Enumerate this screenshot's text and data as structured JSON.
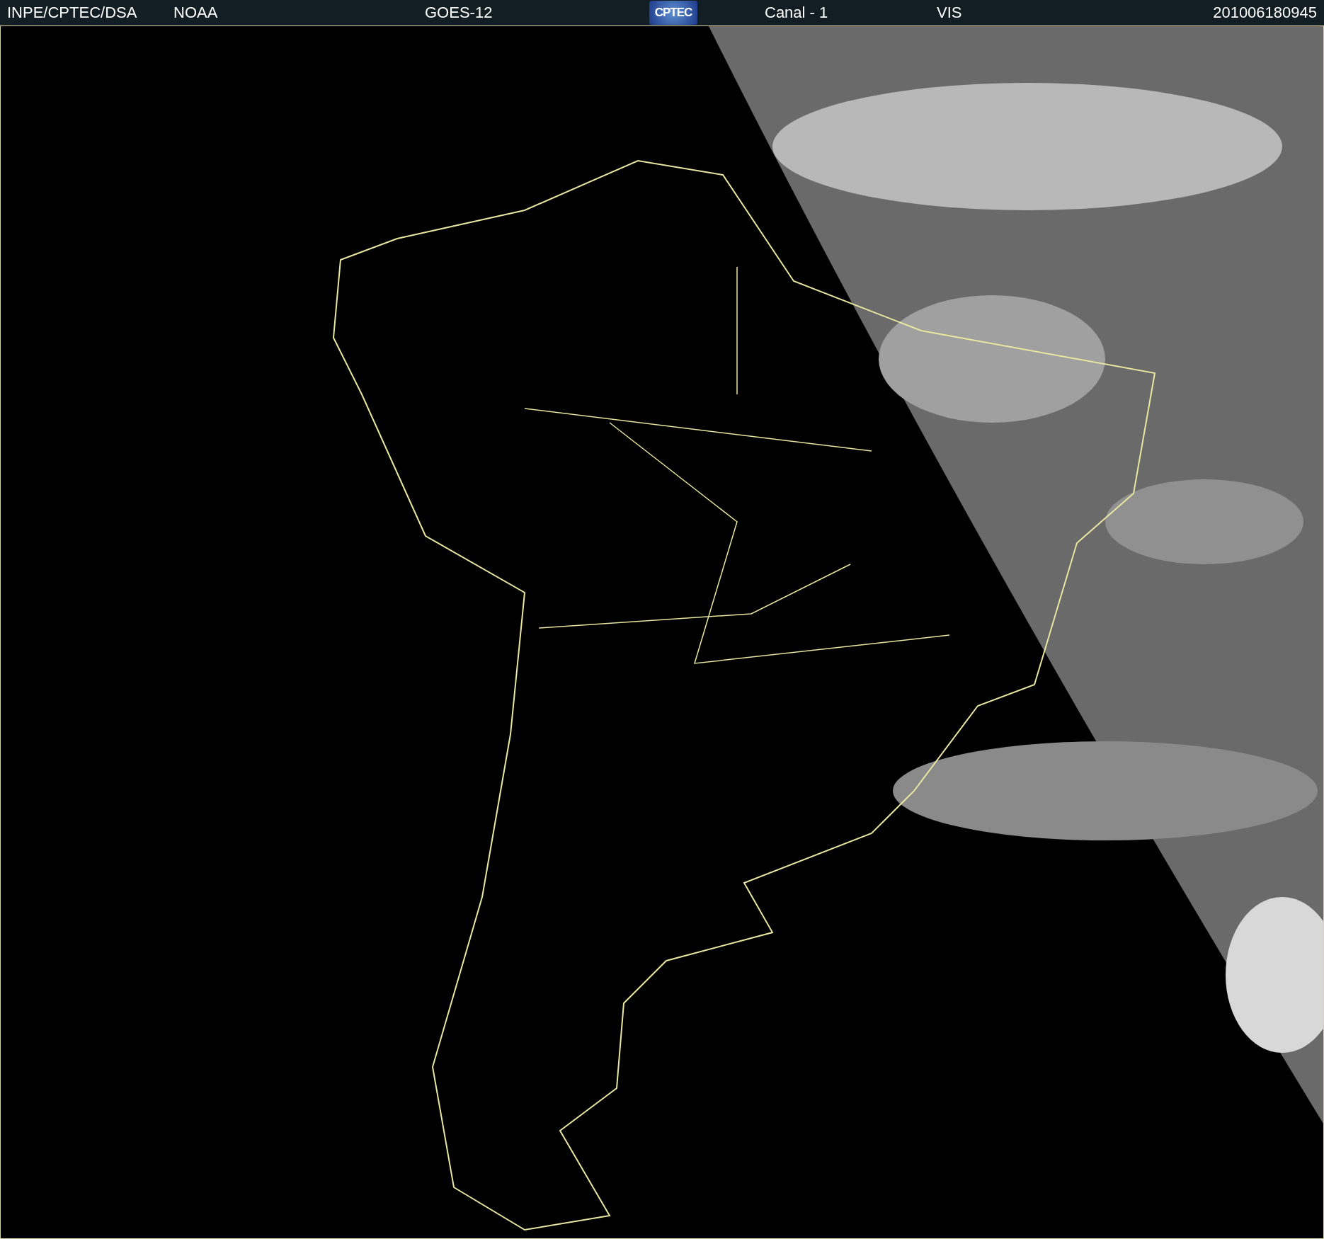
{
  "header": {
    "source": "INPE/CPTEC/DSA",
    "agency": "NOAA",
    "satellite": "GOES-12",
    "logo": "CPTEC",
    "channel": "Canal - 1",
    "band": "VIS",
    "timestamp": "201006180945"
  }
}
